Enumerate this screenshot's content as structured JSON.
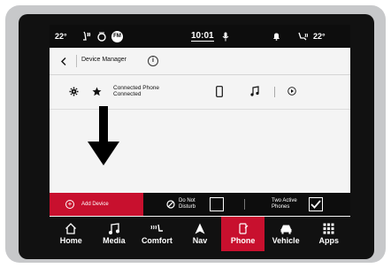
{
  "status": {
    "temp_left": "22°",
    "time": "10:01",
    "temp_right": "22°",
    "fm_badge": "FM"
  },
  "header": {
    "title": "Device Manager",
    "info": "i"
  },
  "device": {
    "name": "Connected Phone",
    "state": "Connected"
  },
  "action_bar": {
    "add_device": "Add Device",
    "dnd_line1": "Do Not",
    "dnd_line2": "Disturb",
    "dnd_checked": false,
    "two_line1": "Two Active",
    "two_line2": "Phones",
    "two_checked": true
  },
  "nav": {
    "items": [
      {
        "label": "Home",
        "icon": "home-icon"
      },
      {
        "label": "Media",
        "icon": "music-note-icon"
      },
      {
        "label": "Comfort",
        "icon": "seat-heat-icon"
      },
      {
        "label": "Nav",
        "icon": "navigation-arrow-icon"
      },
      {
        "label": "Phone",
        "icon": "phone-icon"
      },
      {
        "label": "Vehicle",
        "icon": "car-icon"
      },
      {
        "label": "Apps",
        "icon": "apps-grid-icon"
      }
    ],
    "active": "Phone"
  },
  "colors": {
    "accent_red": "#c8102e",
    "bar_black": "#0d0d0d"
  }
}
